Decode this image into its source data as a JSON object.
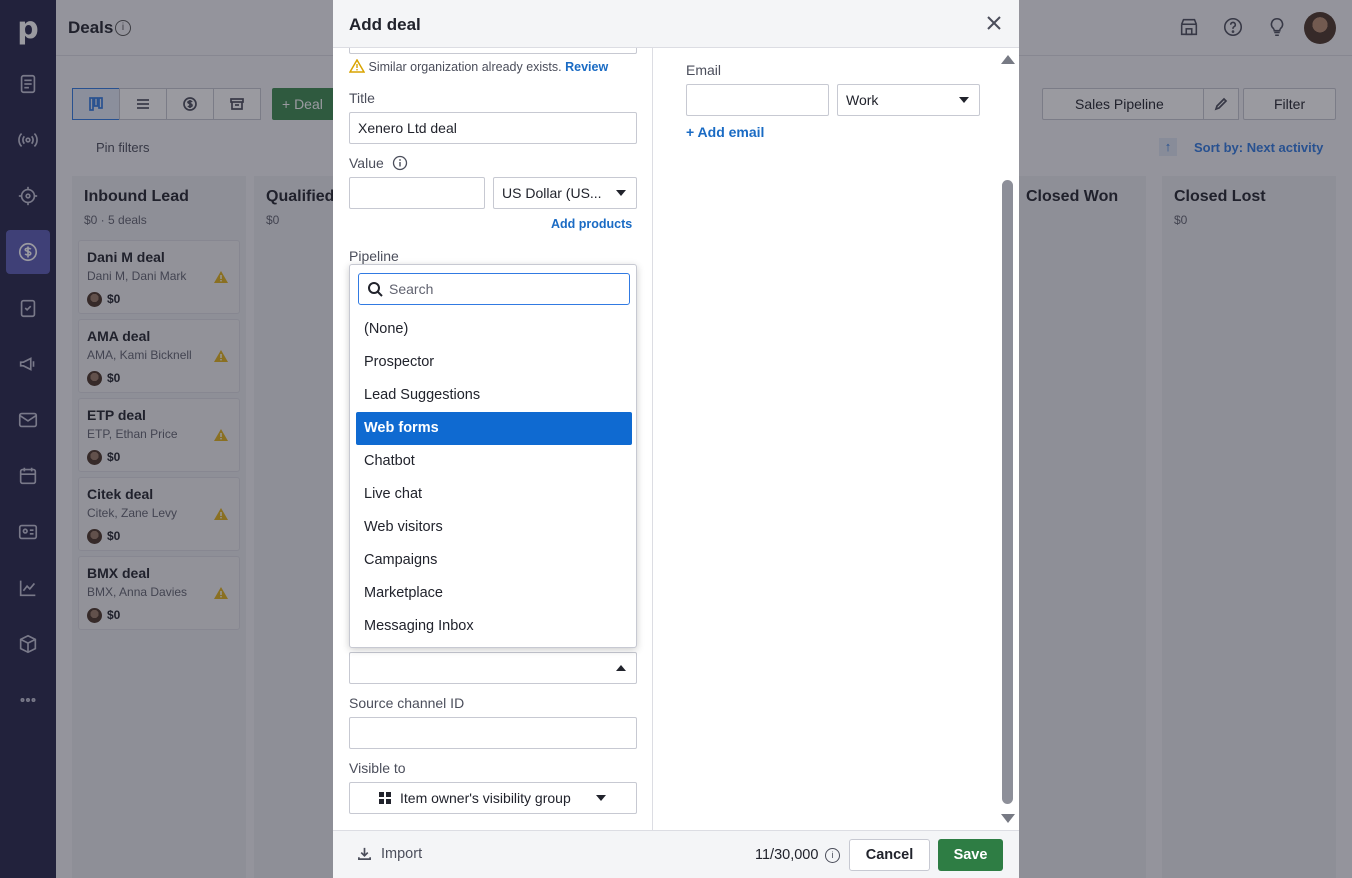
{
  "app": {
    "logo": "p",
    "page_title": "Deals",
    "title_info": "i"
  },
  "toolbar": {
    "deal_button": "+ Deal",
    "pipeline": "Sales Pipeline",
    "filter": "Filter",
    "pin_filters": "Pin filters",
    "sort_by": "Sort by: Next activity"
  },
  "board": {
    "stages": [
      {
        "name": "Inbound Lead",
        "sub": "$0 · 5 deals"
      },
      {
        "name": "Qualified",
        "sub": "$0"
      },
      {
        "name": "Closed Won",
        "sub": ""
      },
      {
        "name": "Closed Lost",
        "sub": "$0"
      }
    ],
    "cards": [
      {
        "title": "Dani M deal",
        "people": "Dani M, Dani Mark",
        "value": "$0"
      },
      {
        "title": "AMA deal",
        "people": "AMA, Kami Bicknell",
        "value": "$0"
      },
      {
        "title": "ETP deal",
        "people": "ETP, Ethan Price",
        "value": "$0"
      },
      {
        "title": "Citek deal",
        "people": "Citek, Zane Levy",
        "value": "$0"
      },
      {
        "title": "BMX deal",
        "people": "BMX, Anna Davies",
        "value": "$0"
      }
    ]
  },
  "modal": {
    "title": "Add deal",
    "warning_text": "Similar organization already exists.",
    "warning_link": "Review",
    "title_label": "Title",
    "title_value": "Xenero Ltd deal",
    "value_label": "Value",
    "value_value": "",
    "currency": "US Dollar (US...",
    "add_products": "Add products",
    "pipeline_label": "Pipeline",
    "source_channel_value": "",
    "source_channel_id_label": "Source channel ID",
    "source_channel_id_value": "",
    "visible_to_label": "Visible to",
    "visible_to_value": "Item owner's visibility group",
    "email_label": "Email",
    "email_value": "",
    "email_type": "Work",
    "add_email": "+ Add email"
  },
  "dropdown": {
    "search_placeholder": "Search",
    "options": [
      {
        "label": "(None)",
        "selected": false
      },
      {
        "label": "Prospector",
        "selected": false
      },
      {
        "label": "Lead Suggestions",
        "selected": false
      },
      {
        "label": "Web forms",
        "selected": true
      },
      {
        "label": "Chatbot",
        "selected": false
      },
      {
        "label": "Live chat",
        "selected": false
      },
      {
        "label": "Web visitors",
        "selected": false
      },
      {
        "label": "Campaigns",
        "selected": false
      },
      {
        "label": "Marketplace",
        "selected": false
      },
      {
        "label": "Messaging Inbox",
        "selected": false
      }
    ]
  },
  "footer": {
    "import": "Import",
    "count": "11/30,000",
    "count_info": "i",
    "cancel": "Cancel",
    "save": "Save"
  },
  "colors": {
    "nav_bg": "#26264a",
    "accent": "#317ae2",
    "selected_option": "#0f6ad1",
    "save_green": "#2e7d44",
    "warning": "#e2b21b"
  }
}
